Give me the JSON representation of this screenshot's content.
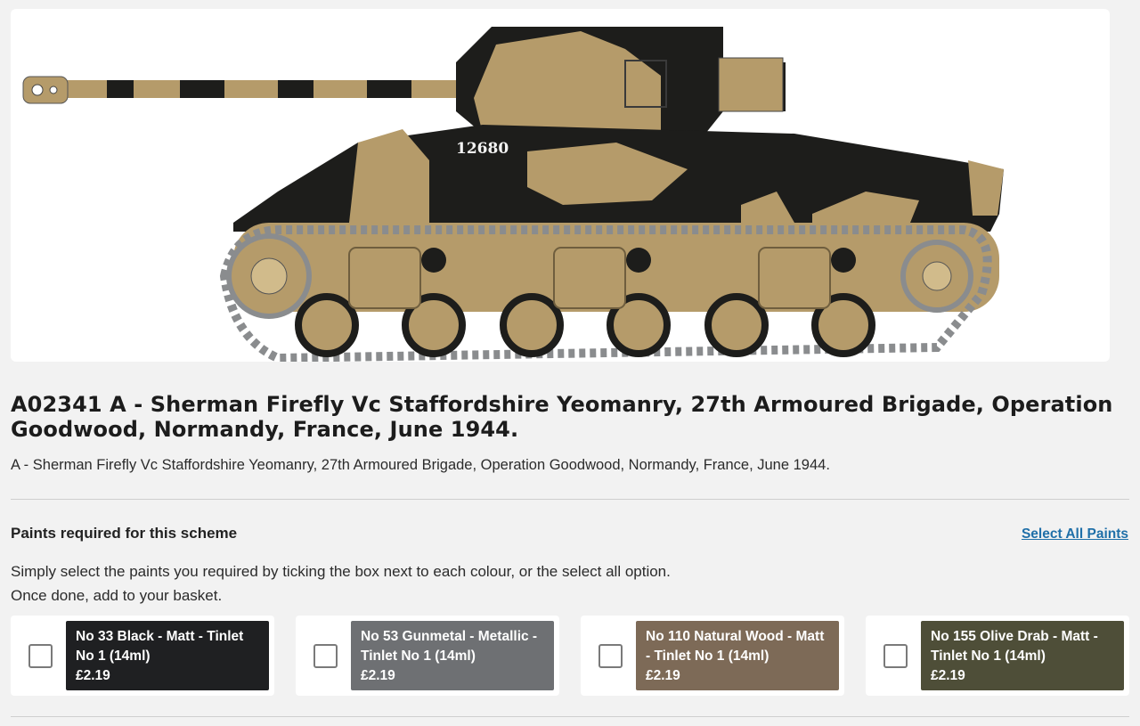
{
  "product": {
    "title": "A02341 A - Sherman Firefly Vc Staffordshire Yeomanry, 27th Armoured Brigade, Operation Goodwood, Normandy, France, June 1944.",
    "subtitle": "A - Sherman Firefly Vc Staffordshire Yeomanry, 27th Armoured Brigade, Operation Goodwood, Normandy, France, June 1944.",
    "image": {
      "icon": "sherman-firefly-tank-illustration",
      "marking": "12680",
      "colors": {
        "sand": "#b59b6a",
        "black": "#1d1d1b",
        "track": "#8a8c8e"
      }
    }
  },
  "paints": {
    "heading": "Paints required for this scheme",
    "select_all_label": "Select All Paints",
    "instructions_line1": "Simply select the paints you required by ticking the box next to each colour, or the select all option.",
    "instructions_line2": "Once done, add to your basket.",
    "items": [
      {
        "name": "No 33 Black - Matt - Tinlet No 1 (14ml)",
        "price": "£2.19",
        "color": "#1f2022",
        "checked": false
      },
      {
        "name": "No 53 Gunmetal - Metallic - Tinlet No 1 (14ml)",
        "price": "£2.19",
        "color": "#6e7073",
        "checked": false
      },
      {
        "name": "No 110 Natural Wood - Matt - Tinlet No 1 (14ml)",
        "price": "£2.19",
        "color": "#7d6a57",
        "checked": false
      },
      {
        "name": "No 155 Olive Drab - Matt - Tinlet No 1 (14ml)",
        "price": "£2.19",
        "color": "#4e4e38",
        "checked": false
      }
    ]
  }
}
